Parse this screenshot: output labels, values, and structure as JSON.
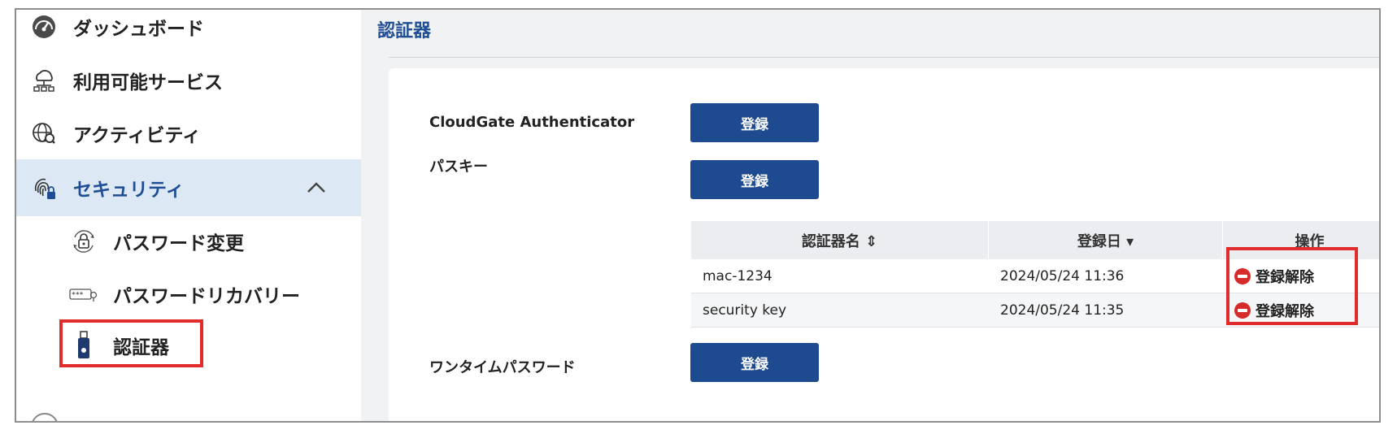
{
  "sidebar": {
    "items": [
      {
        "label": "ダッシュボード",
        "icon": "dashboard-icon"
      },
      {
        "label": "利用可能サービス",
        "icon": "cloud-network-icon"
      },
      {
        "label": "アクティビティ",
        "icon": "globe-search-icon"
      },
      {
        "label": "セキュリティ",
        "icon": "fingerprint-lock-icon",
        "active": true,
        "expanded": true
      },
      {
        "label": "パスワード変更",
        "icon": "lock-refresh-icon"
      },
      {
        "label": "パスワードリカバリー",
        "icon": "password-key-icon"
      },
      {
        "label": "認証器",
        "icon": "usb-key-icon",
        "highlighted": true
      }
    ]
  },
  "main": {
    "title": "認証器",
    "sections": [
      {
        "label": "CloudGate Authenticator",
        "button": "登録"
      },
      {
        "label": "パスキー",
        "button": "登録"
      },
      {
        "label": "ワンタイムパスワード",
        "button": "登録"
      }
    ],
    "table": {
      "headers": [
        "認証器名 ⇕",
        "登録日 ▾",
        "操作"
      ],
      "rows": [
        {
          "name": "mac-1234",
          "date": "2024/05/24 11:36",
          "action": "登録解除"
        },
        {
          "name": "security key",
          "date": "2024/05/24 11:35",
          "action": "登録解除"
        }
      ]
    }
  },
  "colors": {
    "accent": "#1f4e94",
    "button": "#1e4a8f",
    "highlight": "#e02c2c",
    "active_bg": "#dce9f5",
    "danger": "#d62b2b"
  }
}
